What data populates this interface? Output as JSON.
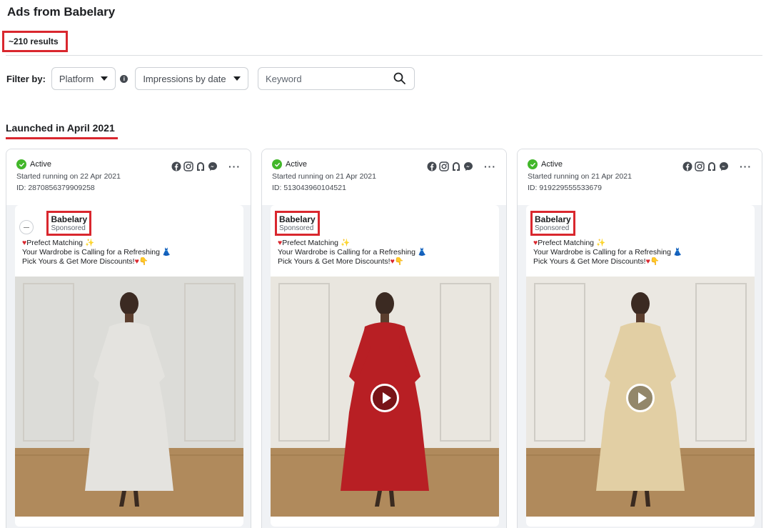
{
  "header": {
    "title": "Ads from Babelary",
    "results": "~210 results"
  },
  "filters": {
    "label": "Filter by:",
    "platform": "Platform",
    "impressions": "Impressions by date",
    "keyword_placeholder": "Keyword"
  },
  "section": {
    "title": "Launched in April 2021"
  },
  "platform_icons": [
    "facebook-icon",
    "instagram-icon",
    "audience-network-icon",
    "messenger-icon"
  ],
  "cards": [
    {
      "status": "Active",
      "started": "Started running on 22 Apr 2021",
      "id": "ID: 2870856379909258",
      "brand": "Babelary",
      "sponsored": "Sponsored",
      "line1": "Prefect Matching",
      "line2": "Your Wardrobe is Calling for a Refreshing",
      "line3": "Pick Yours & Get More Discounts!",
      "has_video": false,
      "dress_color": "#e4e3df",
      "bg_color": "#dcdcd8"
    },
    {
      "status": "Active",
      "started": "Started running on 21 Apr 2021",
      "id": "ID: 513043960104521",
      "brand": "Babelary",
      "sponsored": "Sponsored",
      "line1": "Prefect Matching",
      "line2": "Your Wardrobe is Calling for a Refreshing",
      "line3": "Pick Yours & Get More Discounts!",
      "has_video": true,
      "dress_color": "#b81f24",
      "bg_color": "#e9e6df"
    },
    {
      "status": "Active",
      "started": "Started running on 21 Apr 2021",
      "id": "ID: 919229555533679",
      "brand": "Babelary",
      "sponsored": "Sponsored",
      "line1": "Prefect Matching",
      "line2": "Your Wardrobe is Calling for a Refreshing",
      "line3": "Pick Yours & Get More Discounts!",
      "has_video": true,
      "dress_color": "#e2cfa4",
      "bg_color": "#ebe8e2"
    }
  ],
  "colors": {
    "highlight": "#d9272e",
    "active": "#42b72a"
  }
}
